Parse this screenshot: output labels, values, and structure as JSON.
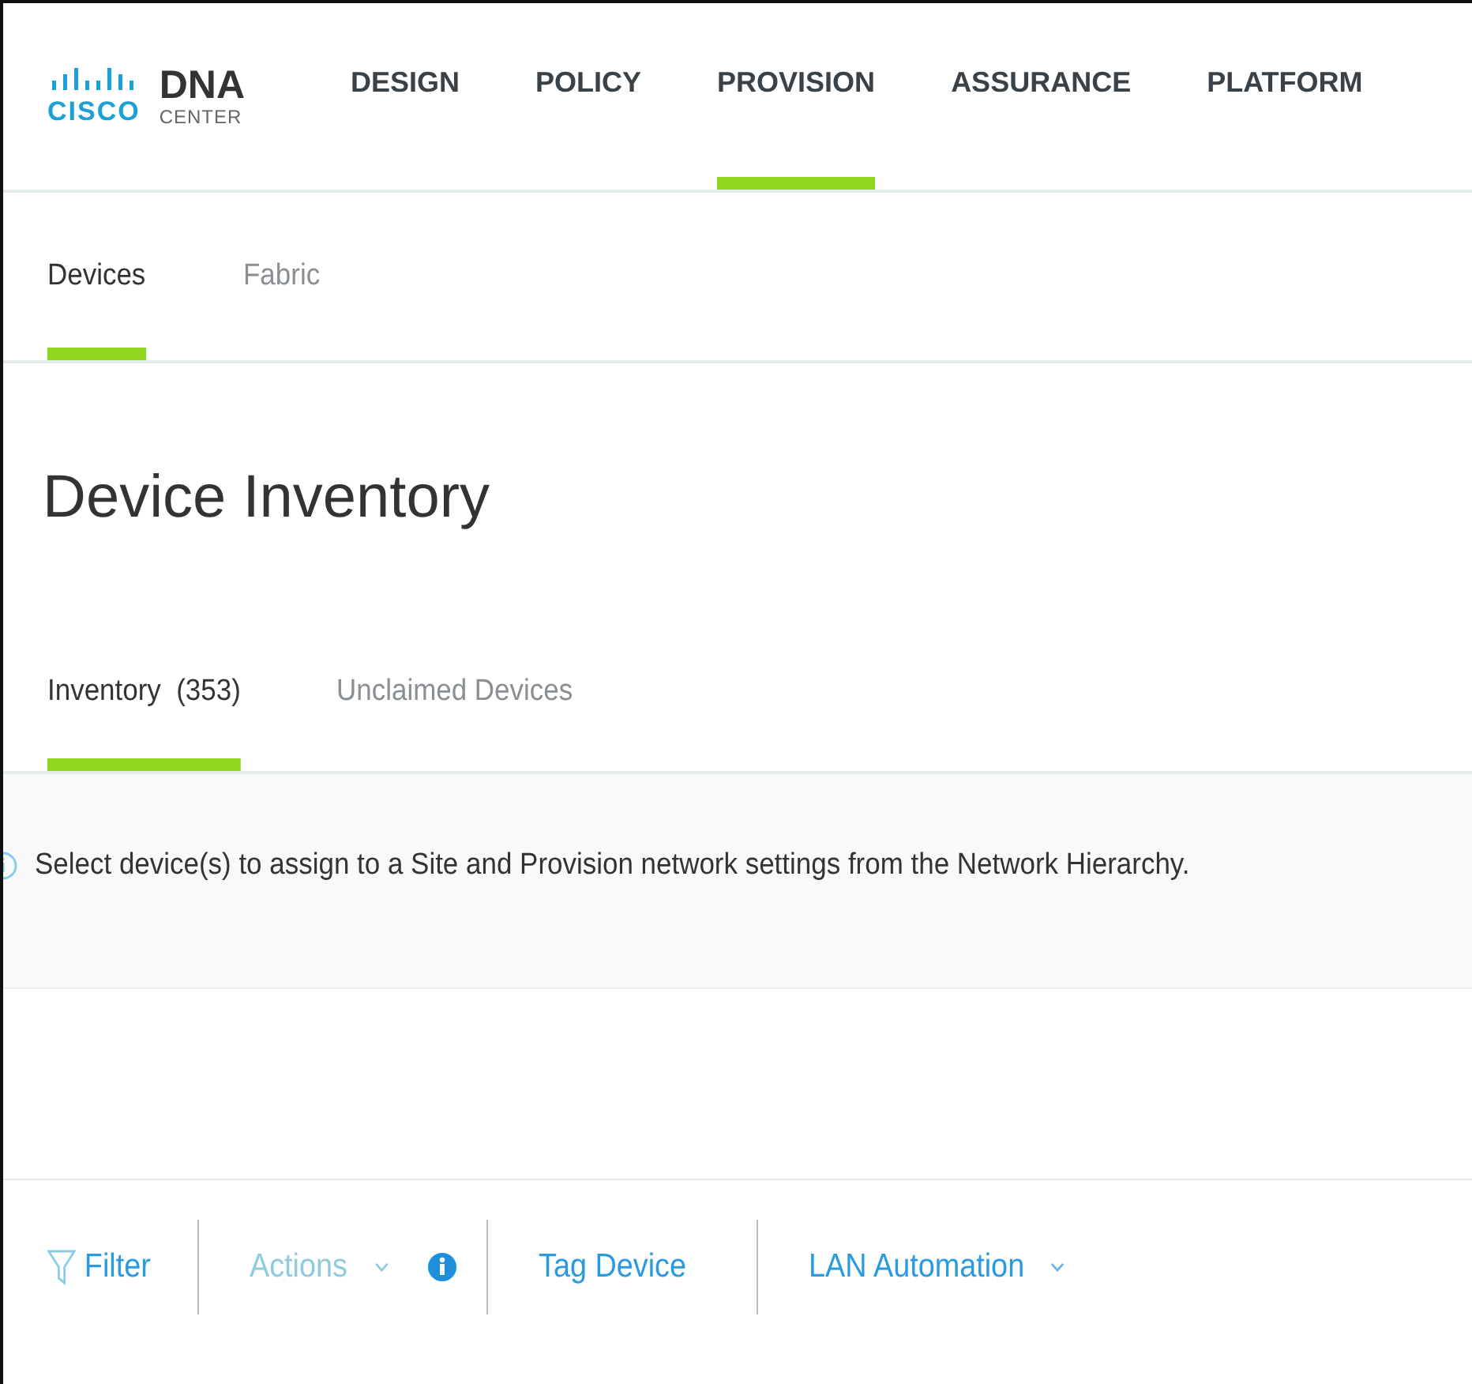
{
  "logo": {
    "brand": "CISCO",
    "product": "DNA",
    "subtitle": "CENTER"
  },
  "nav": [
    {
      "label": "DESIGN",
      "selected": false
    },
    {
      "label": "POLICY",
      "selected": false
    },
    {
      "label": "PROVISION",
      "selected": true
    },
    {
      "label": "ASSURANCE",
      "selected": false
    },
    {
      "label": "PLATFORM",
      "selected": false
    }
  ],
  "subtabs": [
    {
      "label": "Devices",
      "selected": true
    },
    {
      "label": "Fabric",
      "selected": false
    }
  ],
  "page_title": "Device Inventory",
  "inventory_tabs": [
    {
      "label": "Inventory  (353)",
      "selected": true
    },
    {
      "label": "Unclaimed Devices",
      "selected": false
    }
  ],
  "banner": {
    "text": "Select device(s) to assign to a Site and Provision network settings from the Network Hierarchy."
  },
  "toolbar": [
    {
      "kind": "filter",
      "label": "Filter",
      "disabled": false
    },
    {
      "kind": "dropdown",
      "label": "Actions",
      "disabled": true,
      "info": true
    },
    {
      "kind": "button",
      "label": "Tag Device",
      "disabled": false
    },
    {
      "kind": "dropdown",
      "label": "LAN Automation",
      "disabled": false,
      "info": false
    }
  ]
}
